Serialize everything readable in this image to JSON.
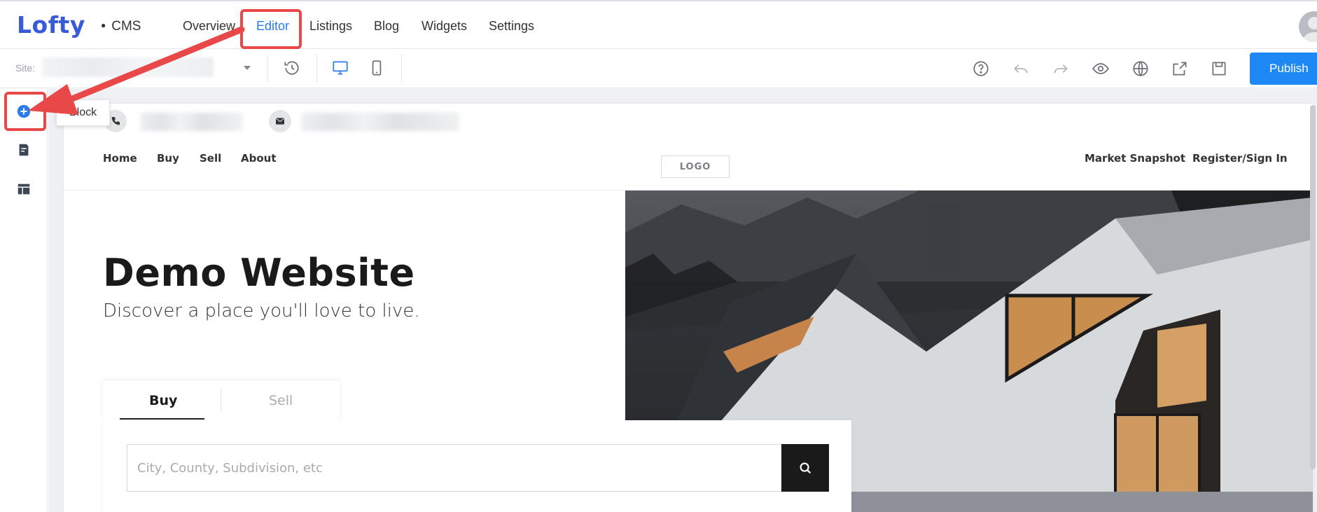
{
  "topnav": {
    "logo": "Lofty",
    "product": "CMS",
    "items": [
      {
        "label": "Overview"
      },
      {
        "label": "Editor",
        "active": true
      },
      {
        "label": "Listings"
      },
      {
        "label": "Blog"
      },
      {
        "label": "Widgets"
      },
      {
        "label": "Settings"
      }
    ]
  },
  "toolbar": {
    "site_label": "Site:",
    "icons": [
      "history-icon",
      "desktop-icon",
      "mobile-icon",
      "help-icon",
      "undo-icon",
      "redo-icon",
      "preview-eye-icon",
      "globe-icon",
      "share-icon",
      "save-icon"
    ],
    "publish_label": "Publish"
  },
  "leftrail": {
    "items": [
      "add-block-icon",
      "pages-icon",
      "layout-icon"
    ],
    "tooltip": "Block"
  },
  "website": {
    "nav_left": [
      "Home",
      "Buy",
      "Sell",
      "About"
    ],
    "logo_text": "LOGO",
    "nav_right": [
      "Market Snapshot",
      "Register/Sign In"
    ],
    "hero_title": "Demo Website",
    "hero_subtitle": "Discover a place you'll love to live.",
    "tabs": {
      "buy": "Buy",
      "sell": "Sell"
    },
    "search_placeholder": "City, County, Subdivision, etc"
  },
  "colors": {
    "brand": "#3a5bd9",
    "active_nav": "#2a7af0",
    "publish": "#1e88f5",
    "annotation": "#e84848"
  }
}
